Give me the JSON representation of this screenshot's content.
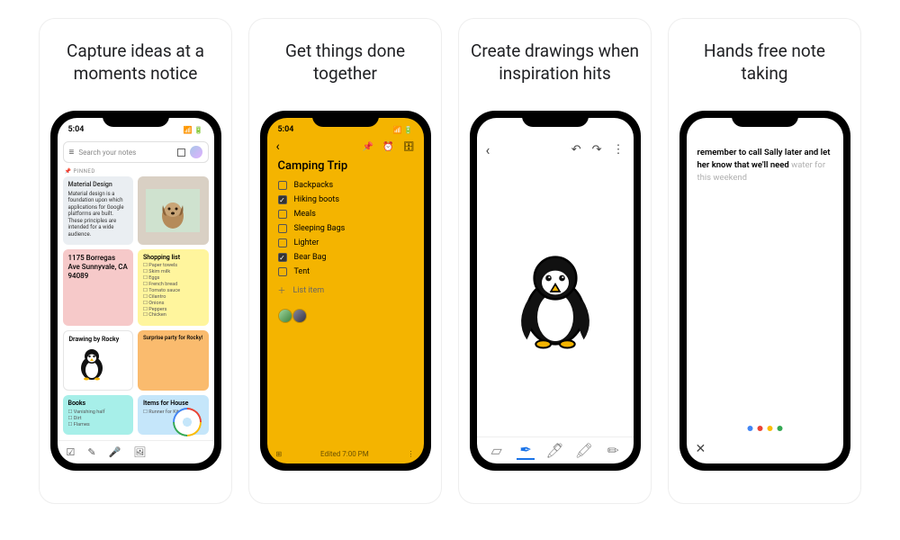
{
  "panels": [
    {
      "headline": "Capture ideas at a moments notice"
    },
    {
      "headline": "Get things done together"
    },
    {
      "headline": "Create drawings when inspiration hits"
    },
    {
      "headline": "Hands free note taking"
    }
  ],
  "status_time": "5:04",
  "p1": {
    "search_placeholder": "Search your notes",
    "pinned_label": "📌  PINNED",
    "notes": {
      "material": {
        "title": "Material Design",
        "body": "Material design is a foundation upon which applications for Google platforms are built. These principles are intended for a wide audience."
      },
      "address": "1175 Borregas Ave Sunnyvale, CA 94089",
      "shopping": {
        "title": "Shopping list",
        "items": [
          "Paper towels",
          "Skim milk",
          "Eggs",
          "French bread",
          "Tomato sauce",
          "Cilantro",
          "Onions",
          "Peppers",
          "Chicken"
        ]
      },
      "drawing_title": "Drawing by Rocky",
      "surprise": "Surprise party for Rocky!",
      "books": {
        "title": "Books",
        "items": [
          "Vanishing half",
          "Dirt",
          "Flames"
        ]
      },
      "house": {
        "title": "Items for House",
        "items": [
          "Runner for Kitchen"
        ]
      }
    }
  },
  "p2": {
    "title": "Camping Trip",
    "items": [
      {
        "label": "Backpacks",
        "checked": false
      },
      {
        "label": "Hiking boots",
        "checked": true
      },
      {
        "label": "Meals",
        "checked": false
      },
      {
        "label": "Sleeping Bags",
        "checked": false
      },
      {
        "label": "Lighter",
        "checked": false
      },
      {
        "label": "Bear Bag",
        "checked": true
      },
      {
        "label": "Tent",
        "checked": false
      }
    ],
    "add_label": "List item",
    "edited": "Edited 7:00 PM"
  },
  "p4": {
    "line_bold": "remember to call Sally later and let her know that we'll need",
    "line_light": " water for this weekend"
  }
}
